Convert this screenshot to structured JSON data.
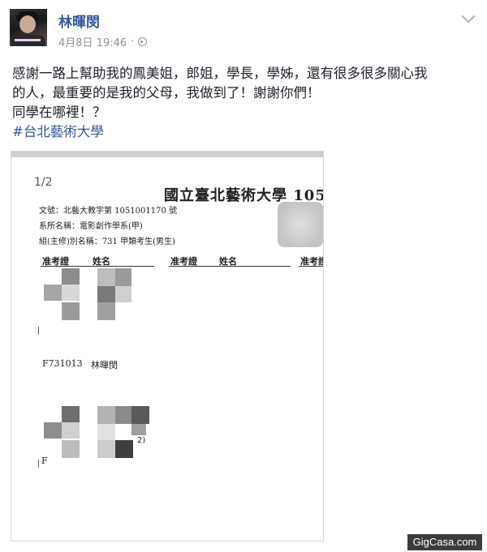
{
  "author": {
    "name": "林暉閔",
    "avatar_icon": "profile-avatar-icon"
  },
  "post_meta": {
    "timestamp": "4月8日 19:46",
    "separator": "·",
    "privacy_icon": "globe-icon"
  },
  "post": {
    "line1": "感謝一路上幫助我的鳳美姐，郎姐，學長，學姊，還有很多很多關心我",
    "line2": "的人，最重要的是我的父母，我做到了！謝謝你們！",
    "line3": "同學在哪裡！？",
    "hashtag": "#台北藝術大學"
  },
  "photo": {
    "page": "1/2",
    "title": "國立臺北藝術大學 105",
    "doc_no": "文號：北藝大教字第 1051001170 號",
    "department": "系所名稱：電影創作學系(甲)",
    "group": "組(主修)別名稱：731 甲類考生(男生)",
    "headers": [
      "准考證",
      "姓名",
      "准考證",
      "姓名",
      "准考證"
    ],
    "row_id": "F731013",
    "row_name": "林暉閔",
    "circle_mark": "2)",
    "partial_char": "F"
  },
  "watermark": "GigCasa.com"
}
